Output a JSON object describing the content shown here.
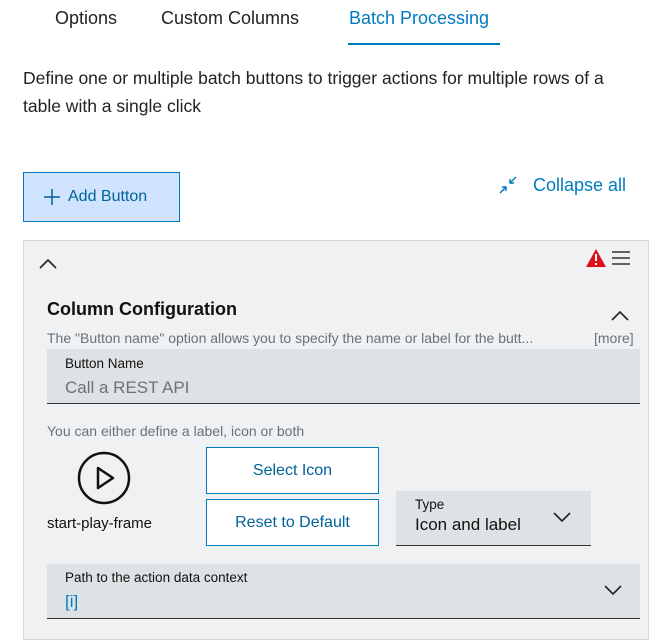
{
  "tabs": [
    {
      "label": "Options"
    },
    {
      "label": "Custom Columns"
    },
    {
      "label": "Batch Processing",
      "active": true
    }
  ],
  "description": "Define one or multiple batch buttons to trigger actions for multiple rows of a table with a single click",
  "add_button_label": "Add Button",
  "collapse_all_label": "Collapse all",
  "config": {
    "title": "Column Configuration",
    "hint": "The \"Button name\" option allows you to specify the name or label for the butt...",
    "more_label": "[more]",
    "button_name": {
      "label": "Button Name",
      "value": "Call a REST API"
    },
    "icon_hint": "You can either define a label, icon or both",
    "icon_name": "start-play-frame",
    "select_icon_label": "Select Icon",
    "reset_default_label": "Reset to Default",
    "type": {
      "label": "Type",
      "value": "Icon and label"
    },
    "path": {
      "label": "Path to the action data context",
      "value": "[i]"
    }
  },
  "icons": {
    "warning": "warning-icon",
    "menu": "menu-icon",
    "chevron_up": "chevron-up-icon",
    "chevron_down": "chevron-down-icon",
    "play": "start-play-frame-icon",
    "collapse": "collapse-icon",
    "plus": "plus-icon"
  },
  "colors": {
    "accent": "#007bc0",
    "accent_light": "#d1e4ff",
    "warning": "#e00f1c",
    "panel_bg": "#eff1f2",
    "field_bg": "#dfe2e4"
  }
}
